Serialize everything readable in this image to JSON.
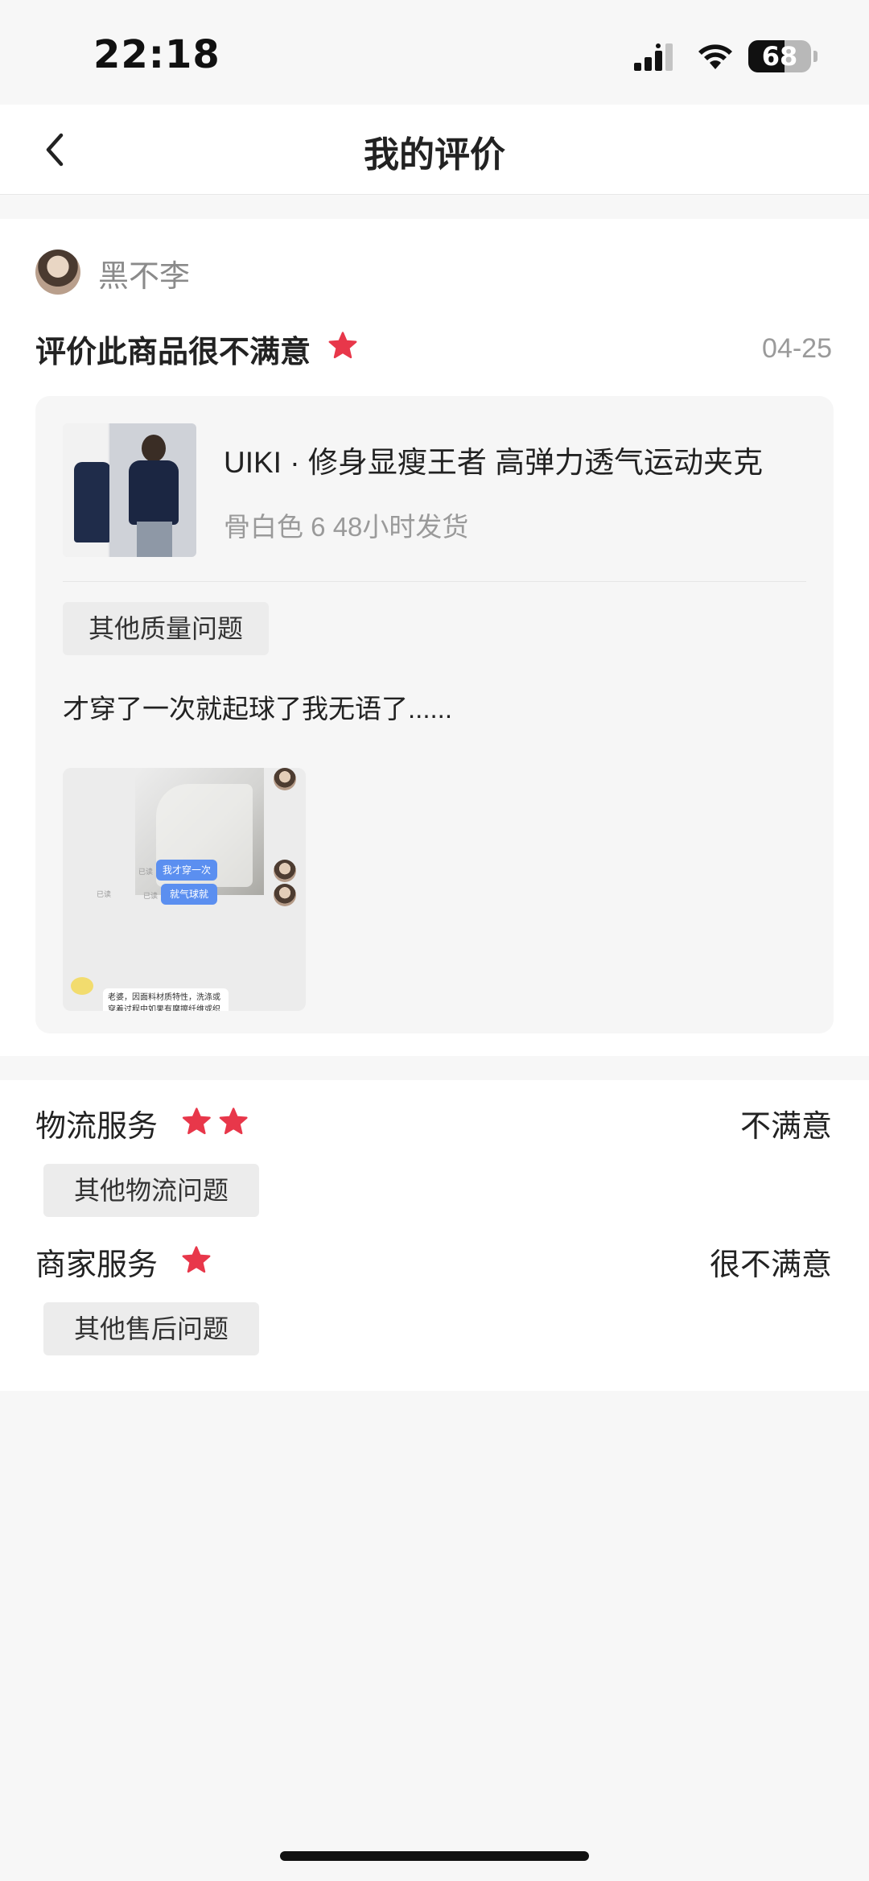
{
  "status_bar": {
    "time": "22:18",
    "battery": "68",
    "icons": [
      "signal-icon",
      "wifi-icon",
      "battery-icon"
    ]
  },
  "nav": {
    "title": "我的评价",
    "back_icon": "chevron-left-icon"
  },
  "review": {
    "username": "黑不李",
    "rating_title": "评价此商品很不满意",
    "rating_stars": 1,
    "date": "04-25",
    "product": {
      "title": "UIKI · 修身显瘦王者 高弹力透气运动夹克",
      "spec": "骨白色 6 48小时发货"
    },
    "tag": "其他质量问题",
    "text": "才穿了一次就起球了我无语了......",
    "image": {
      "bubble_1": "我才穿一次",
      "bubble_2": "就气球就",
      "reply": "老婆，因面料材质特性，洗涤或穿着过程中如果有摩擦纤维或织"
    }
  },
  "services": [
    {
      "label": "物流服务",
      "stars": 2,
      "result": "不满意",
      "tag": "其他物流问题"
    },
    {
      "label": "商家服务",
      "stars": 1,
      "result": "很不满意",
      "tag": "其他售后问题"
    }
  ],
  "colors": {
    "star": "#e8374a",
    "background": "#f7f7f7",
    "card": "#ffffff",
    "bubble": "#5b8ff0"
  }
}
